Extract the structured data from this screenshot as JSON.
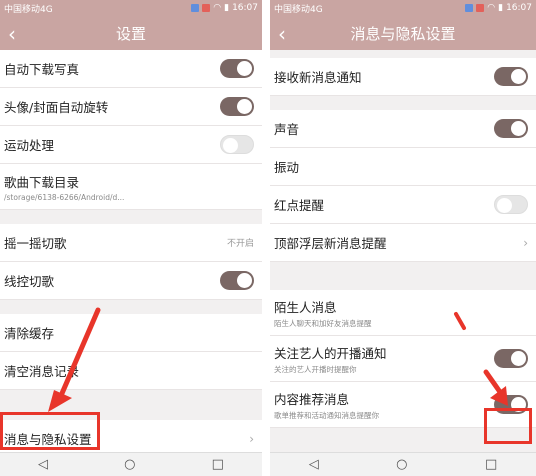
{
  "left": {
    "status": {
      "carrier": "中国移动4G",
      "time": "16:07"
    },
    "title": "设置",
    "rows": [
      {
        "label": "自动下载写真",
        "toggle": "on"
      },
      {
        "label": "头像/封面自动旋转",
        "toggle": "on"
      },
      {
        "label": "运动处理",
        "toggle": "off"
      },
      {
        "label": "歌曲下载目录",
        "sub": "/storage/6138-6266/Android/d..."
      },
      {
        "label": "摇一摇切歌",
        "value": "不开启"
      },
      {
        "label": "线控切歌",
        "toggle": "on"
      },
      {
        "label": "清除缓存"
      },
      {
        "label": "清空消息记录"
      },
      {
        "label": "消息与隐私设置",
        "chevron": "›"
      }
    ]
  },
  "right": {
    "status": {
      "carrier": "中国移动4G",
      "time": "16:07"
    },
    "title": "消息与隐私设置",
    "rows": [
      {
        "label": "接收新消息通知",
        "toggle": "on"
      },
      {
        "label": "声音",
        "toggle": "on"
      },
      {
        "label": "振动"
      },
      {
        "label": "红点提醒",
        "toggle": "off"
      },
      {
        "label": "顶部浮层新消息提醒",
        "chevron": "›"
      },
      {
        "label": "陌生人消息",
        "sub": "陌生人聊天和加好友消息提醒"
      },
      {
        "label": "关注艺人的开播通知",
        "sub": "关注的艺人开播时提醒你",
        "toggle": "on"
      },
      {
        "label": "内容推荐消息",
        "sub": "歌单推荐和活动通知消息提醒你",
        "toggle": "on"
      }
    ]
  },
  "nav": {
    "back": "◁",
    "home": "○",
    "recent": "□"
  },
  "colors": {
    "header": "#c9a5a2",
    "toggle_on": "#7a6764",
    "annotation": "#e8352a"
  }
}
